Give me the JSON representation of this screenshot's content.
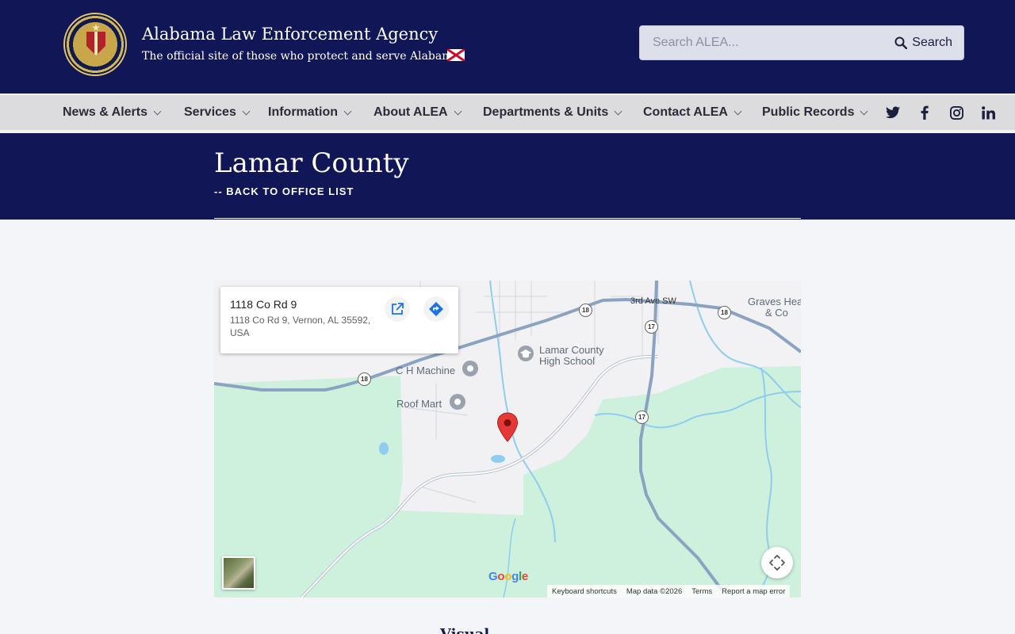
{
  "header": {
    "title": "Alabama Law Enforcement Agency",
    "subtitle": "The official site of those who protect and serve Alabama",
    "search_placeholder": "Search ALEA...",
    "search_button": "Search"
  },
  "nav": {
    "items": [
      {
        "label": "News & Alerts"
      },
      {
        "label": "Services"
      },
      {
        "label": "Information"
      },
      {
        "label": "About ALEA"
      },
      {
        "label": "Departments & Units"
      },
      {
        "label": "Contact ALEA"
      },
      {
        "label": "Public Records"
      }
    ],
    "social": {
      "twitter": "twitter-icon",
      "facebook": "facebook-icon",
      "instagram": "instagram-icon",
      "linkedin": "linkedin-icon"
    }
  },
  "page": {
    "title": "Lamar County",
    "back_link": "-- BACK TO OFFICE LIST",
    "below_text": "Visual"
  },
  "map": {
    "place_name": "1118 Co Rd 9",
    "place_address": "1118 Co Rd 9, Vernon, AL 35592, USA",
    "pois": {
      "ch_machine": "C H Machine",
      "roof_mart": "Roof Mart",
      "school_line1": "Lamar County",
      "school_line2": "High School",
      "graves_line1": "Graves Hea",
      "graves_line2": "& Co"
    },
    "road_labels": {
      "third_ave": "3rd Ave SW"
    },
    "route_shields": {
      "r18a": "18",
      "r18b": "18",
      "r18c": "18",
      "r17a": "17",
      "r17b": "17"
    },
    "google": "Google",
    "attribution": {
      "shortcuts": "Keyboard shortcuts",
      "mapdata": "Map data ©2026",
      "terms": "Terms",
      "report": "Report a map error"
    }
  },
  "colors": {
    "navy": "#111656",
    "nav_bg": "#dcdcdf",
    "map_green": "#cdf1dc",
    "water": "#8ecdf0",
    "road": "#8ba3c2",
    "marker": "#e53935"
  }
}
